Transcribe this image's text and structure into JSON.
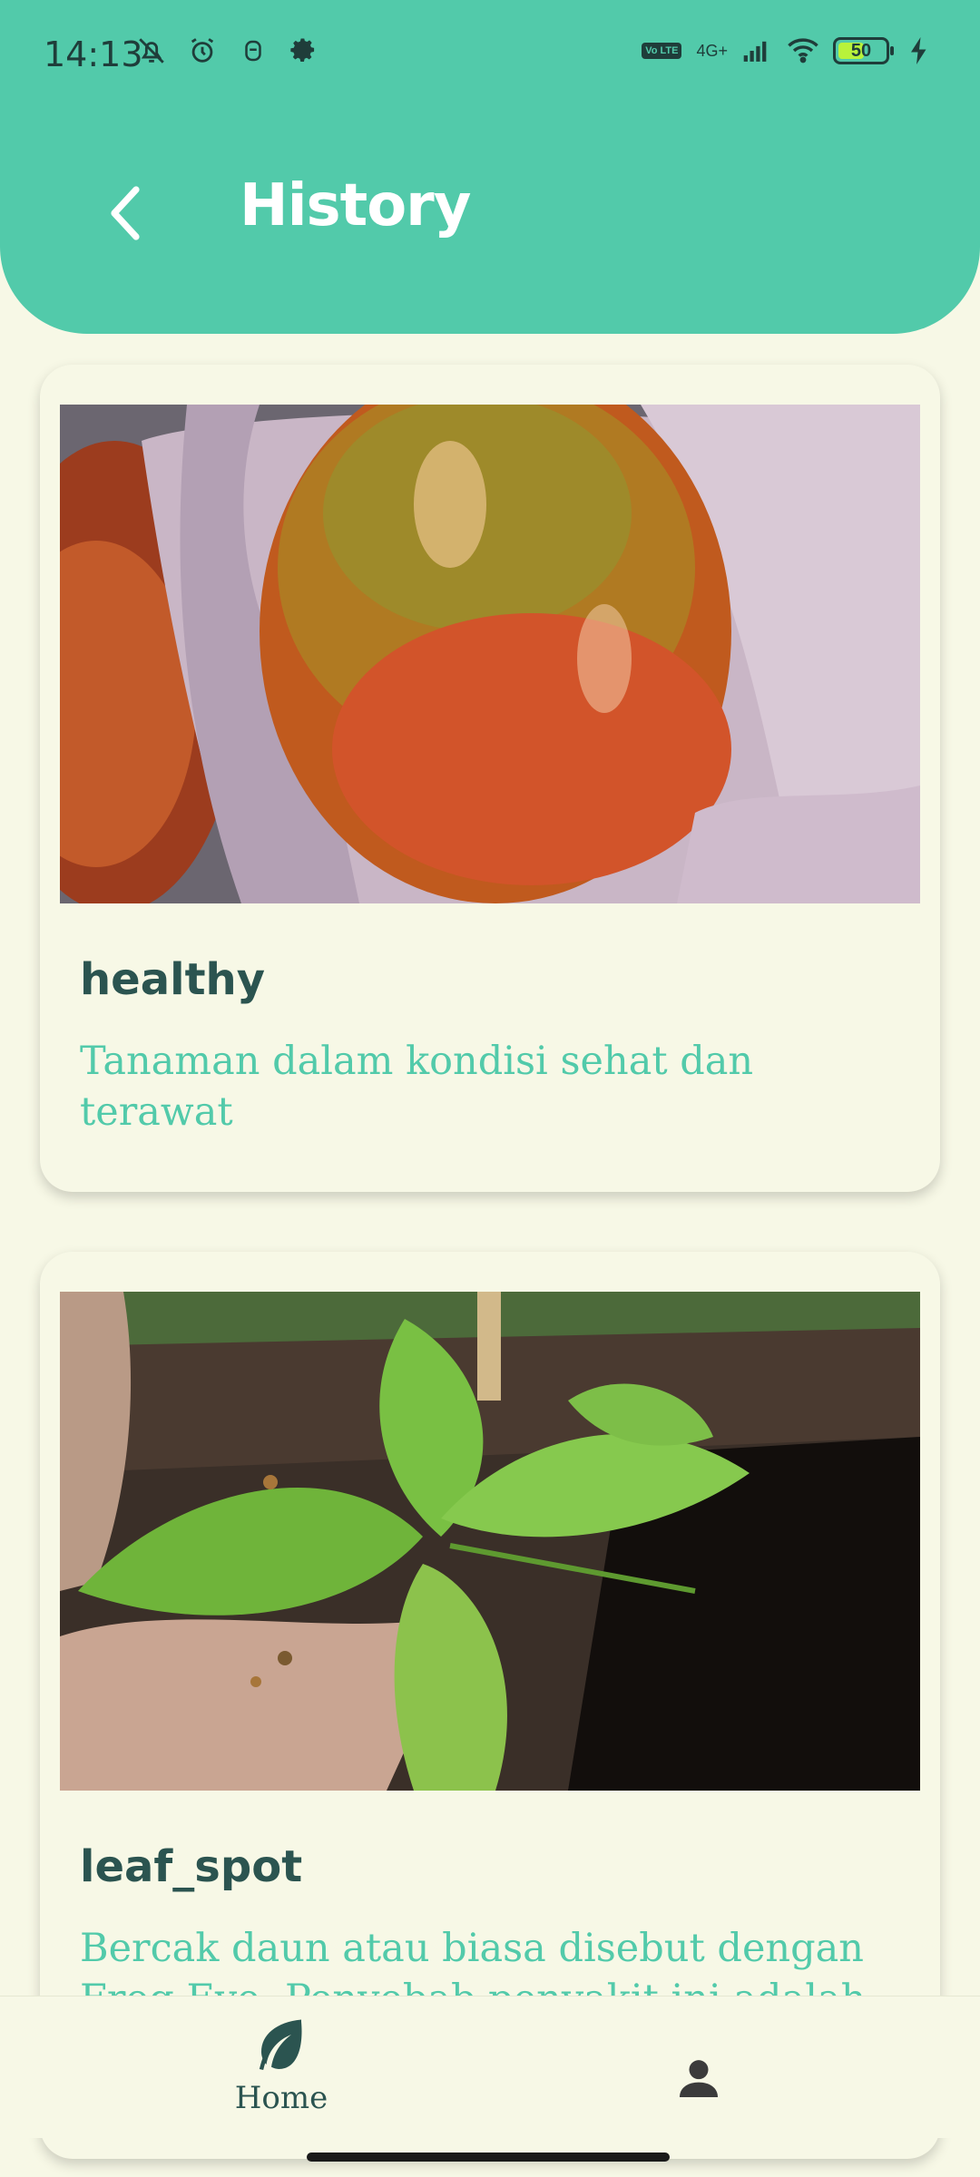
{
  "status_bar": {
    "time": "14:13",
    "network": "4G+",
    "volte": "Vo LTE",
    "battery": "50"
  },
  "header": {
    "title": "History"
  },
  "history": [
    {
      "label": "healthy",
      "description": "Tanaman dalam kondisi sehat dan terawat",
      "image_subject": "tomato-photo"
    },
    {
      "label": "leaf_spot",
      "description": "Bercak daun atau biasa disebut dengan Frog Eye. Penyebab penyakit ini adalah",
      "image_subject": "chili-leaf-photo"
    }
  ],
  "bottom_nav": {
    "home_label": "Home"
  },
  "colors": {
    "accent": "#52CAAA",
    "background": "#F7F8E6",
    "title_text": "#2B5450"
  }
}
